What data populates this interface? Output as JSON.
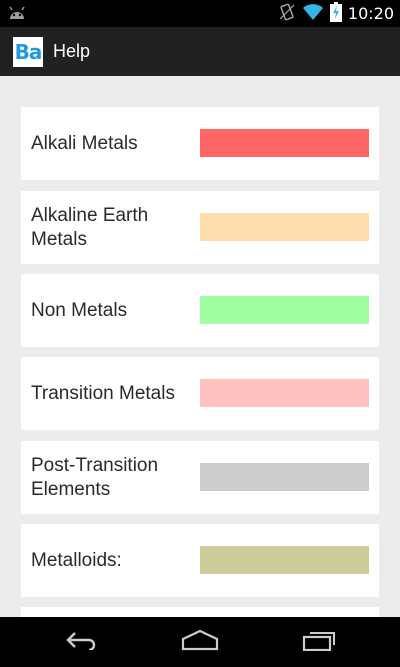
{
  "status_bar": {
    "time": "10:20",
    "icons": [
      "android-debug-icon",
      "vibrate-icon",
      "wifi-icon",
      "battery-charging-icon"
    ]
  },
  "action_bar": {
    "logo_text": "Ba",
    "title": "Help"
  },
  "legend": {
    "items": [
      {
        "label": "Alkali Metals",
        "color": "#ff6666"
      },
      {
        "label": "Alkaline Earth Metals",
        "color": "#ffdead"
      },
      {
        "label": "Non Metals",
        "color": "#a0ffa0"
      },
      {
        "label": "Transition Metals",
        "color": "#ffc0c0"
      },
      {
        "label": "Post-Transition Elements",
        "color": "#cccccc"
      },
      {
        "label": "Metalloids:",
        "color": "#cccc99"
      }
    ]
  },
  "nav_bar": {
    "buttons": [
      "back-icon",
      "home-icon",
      "recents-icon"
    ]
  }
}
